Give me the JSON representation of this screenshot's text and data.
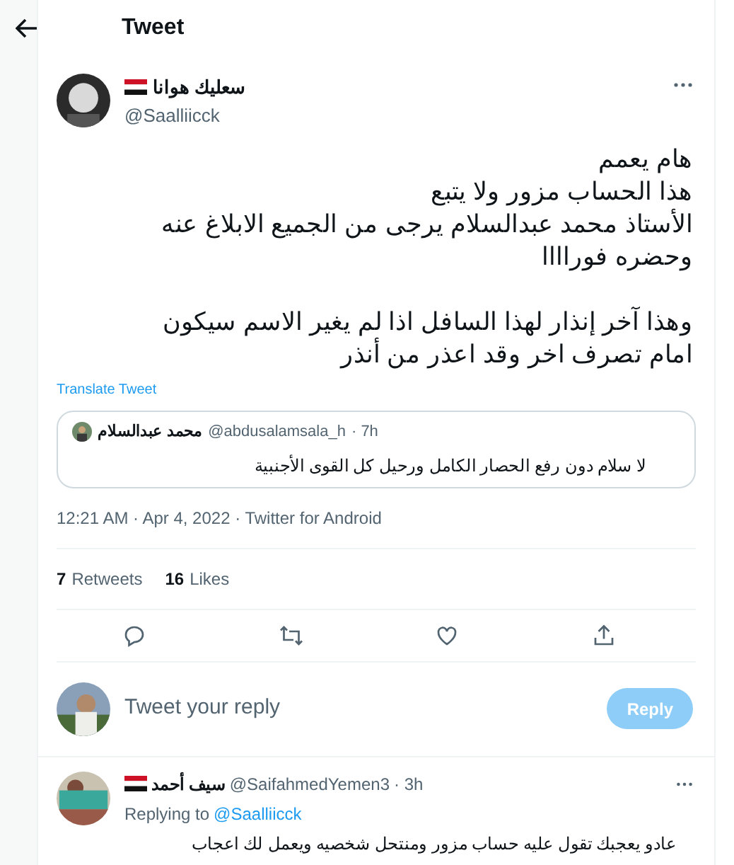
{
  "header": {
    "title": "Tweet"
  },
  "tweet": {
    "author_name": "سعليك هوانا",
    "handle": "@Saalliicck",
    "text": "هام يعمم\nهذا الحساب مزور ولا يتبع\nالأستاذ محمد عبدالسلام يرجى من الجميع الابلاغ عنه وحضره فوراااا\n\nوهذا آخر إنذار لهذا السافل اذا لم يغير الاسم سيكون امام تصرف اخر وقد اعذر من أنذر",
    "translate": "Translate Tweet",
    "quote": {
      "author_name": "محمد عبدالسلام",
      "handle": "@abdusalamsala_h",
      "time": "· 7h",
      "text": "لا سلام دون رفع الحصار الكامل ورحيل كل القوى الأجنبية"
    },
    "meta": "12:21 AM · Apr 4, 2022 · Twitter for Android",
    "retweets": {
      "count": "7",
      "label": "Retweets"
    },
    "likes": {
      "count": "16",
      "label": "Likes"
    }
  },
  "composer": {
    "placeholder": "Tweet your reply",
    "button": "Reply",
    "disabled": true
  },
  "reply": {
    "author_name": "سيف أحمد",
    "handle": "@SaifahmedYemen3",
    "time": "· 3h",
    "replying_prefix": "Replying to",
    "replying_handle": "@Saalliicck",
    "text": "عادو يعجبك تقول عليه حساب مزور ومنتحل شخصيه ويعمل لك اعجاب"
  }
}
